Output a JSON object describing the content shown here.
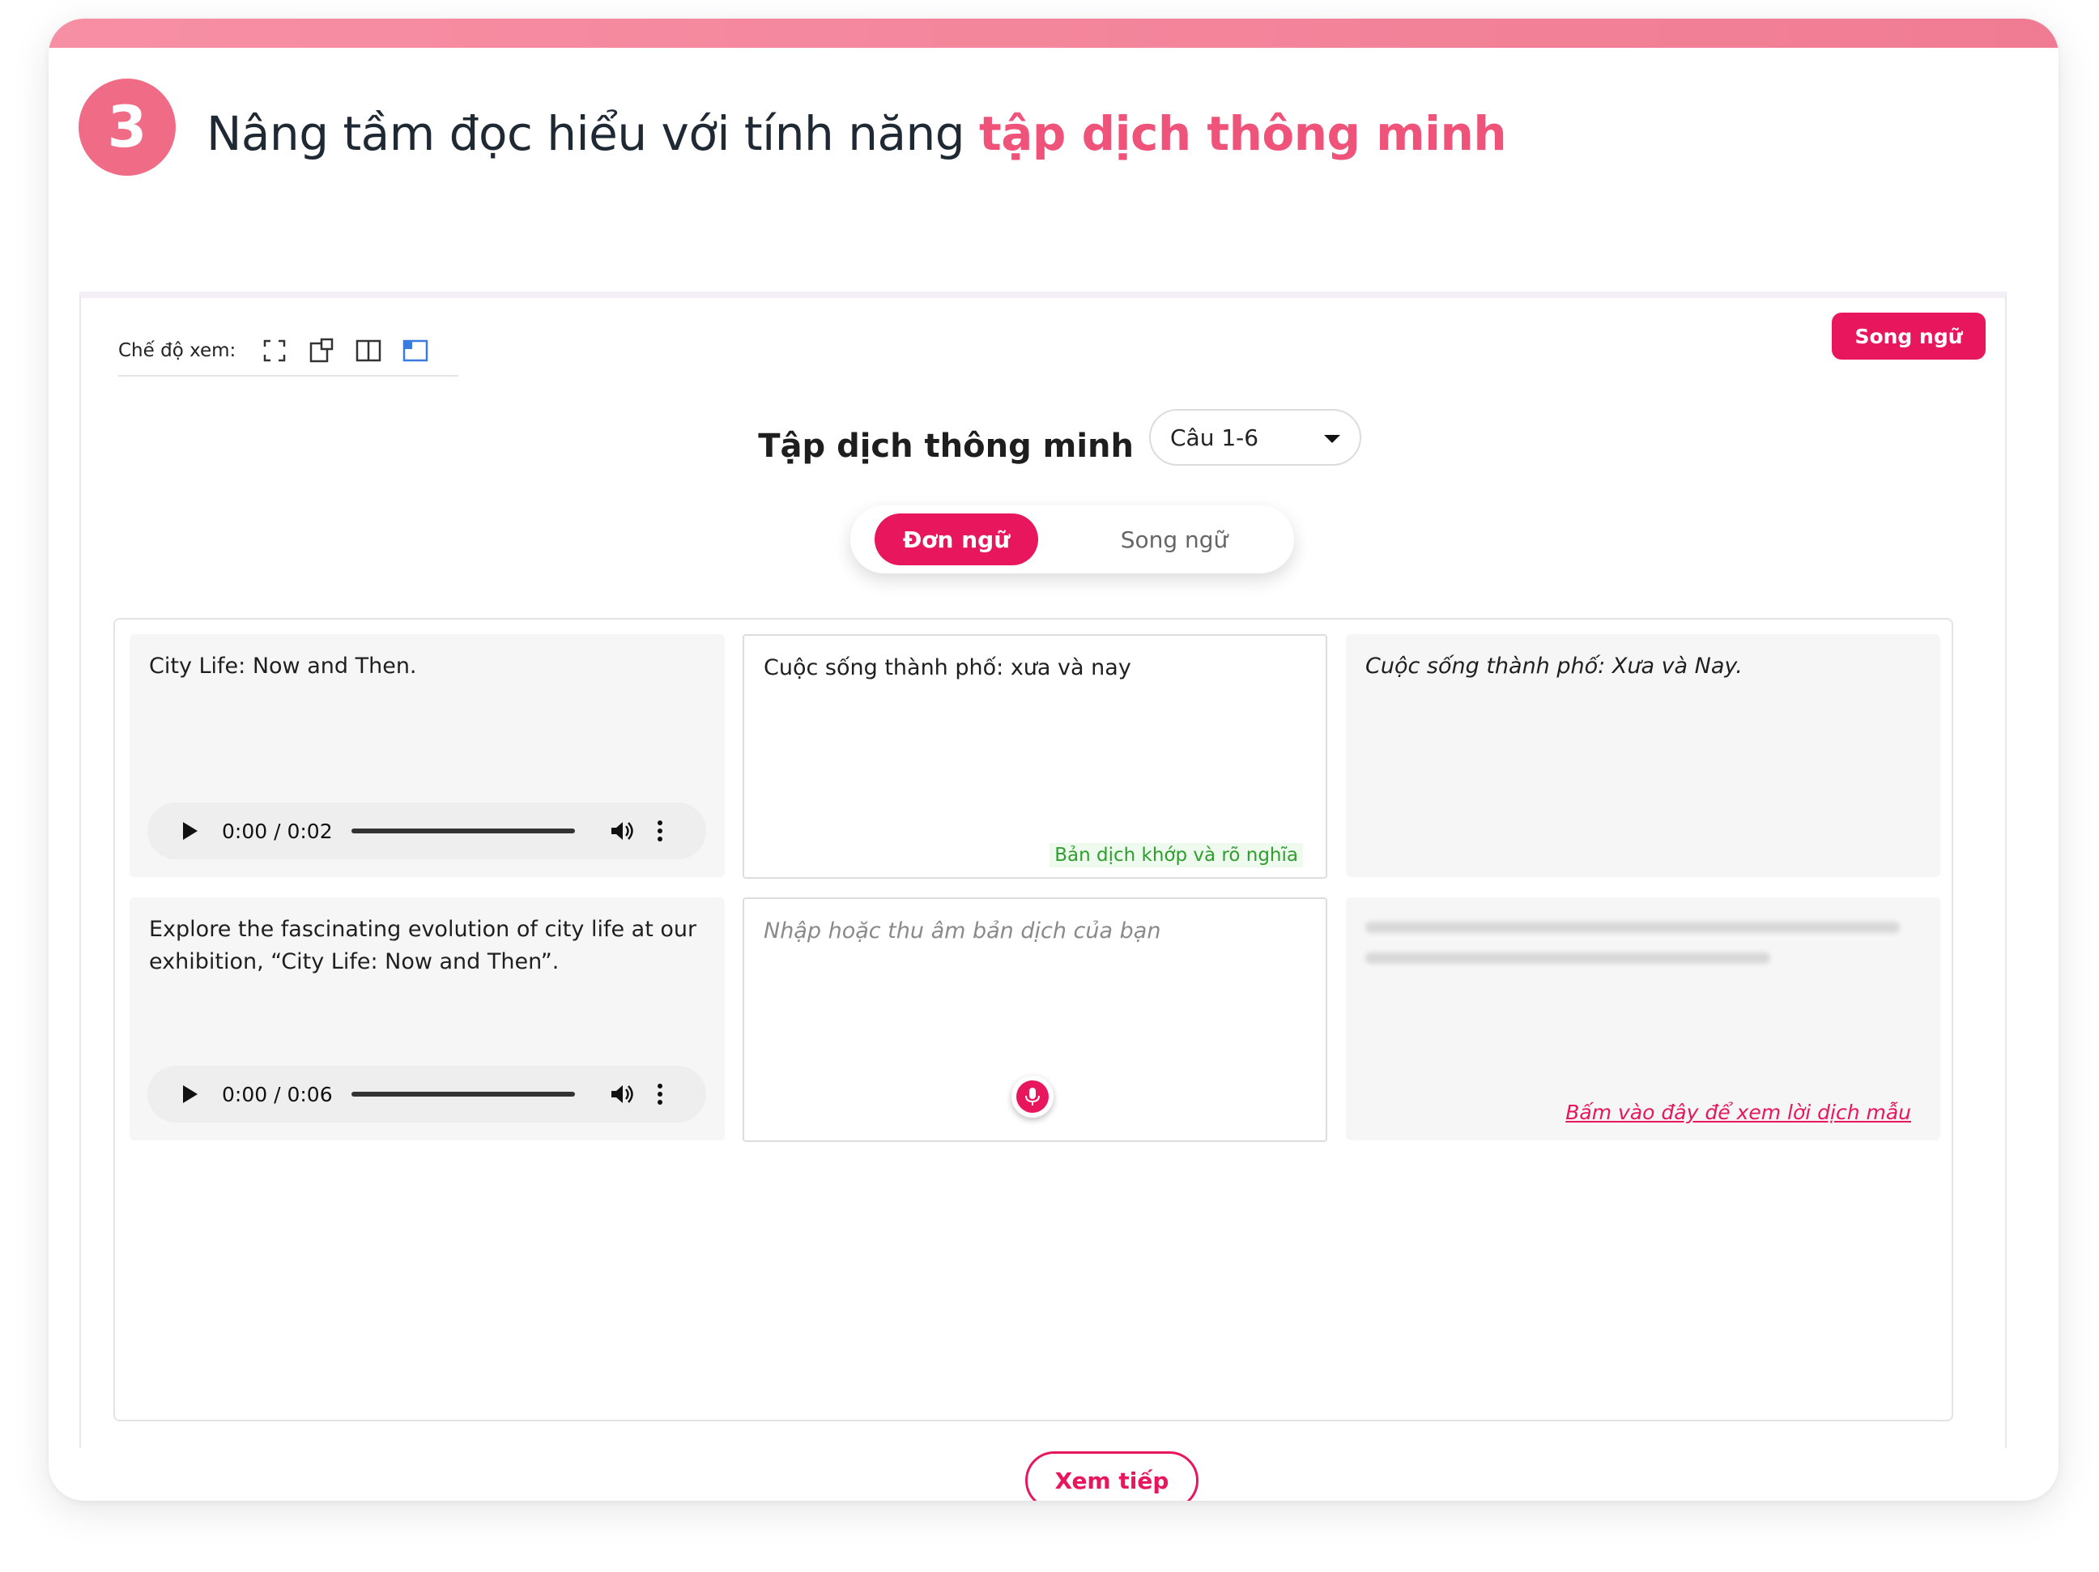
{
  "step": {
    "number": "3"
  },
  "headline": {
    "prefix": "Nâng tầm đọc hiểu với tính năng ",
    "accent": "tập dịch thông minh"
  },
  "toolbar": {
    "viewmode_label": "Chế độ xem:",
    "icons": [
      "fullscreen-icon",
      "popout-icon",
      "split-view-icon",
      "panel-view-icon"
    ],
    "language_badge": "Song ngữ"
  },
  "practice": {
    "title": "Tập dịch thông minh",
    "select_value": "Câu 1-6",
    "modes": {
      "active": "Đơn ngữ",
      "inactive": "Song ngữ"
    }
  },
  "rows": [
    {
      "source": "City Life: Now and Then.",
      "audio_time": "0:00 / 0:02",
      "translation": "Cuộc sống thành phố: xưa và nay",
      "feedback": "Bản dịch khớp và rõ nghĩa",
      "reference": "Cuộc sống thành phố: Xưa và Nay."
    },
    {
      "source": "Explore the fascinating evolution of city life at our exhibition, “City Life: Now and Then”.",
      "audio_time": "0:00 / 0:06",
      "translation_placeholder": "Nhập hoặc thu âm bản dịch của bạn",
      "reference_link": "Bấm vào đây để xem lời dịch mẫu"
    }
  ],
  "footer": {
    "next_label": "Xem tiếp"
  },
  "colors": {
    "accent": "#e8175d",
    "badge": "#f06b86",
    "headline_accent": "#f0537a",
    "success": "#2f9e2f"
  }
}
